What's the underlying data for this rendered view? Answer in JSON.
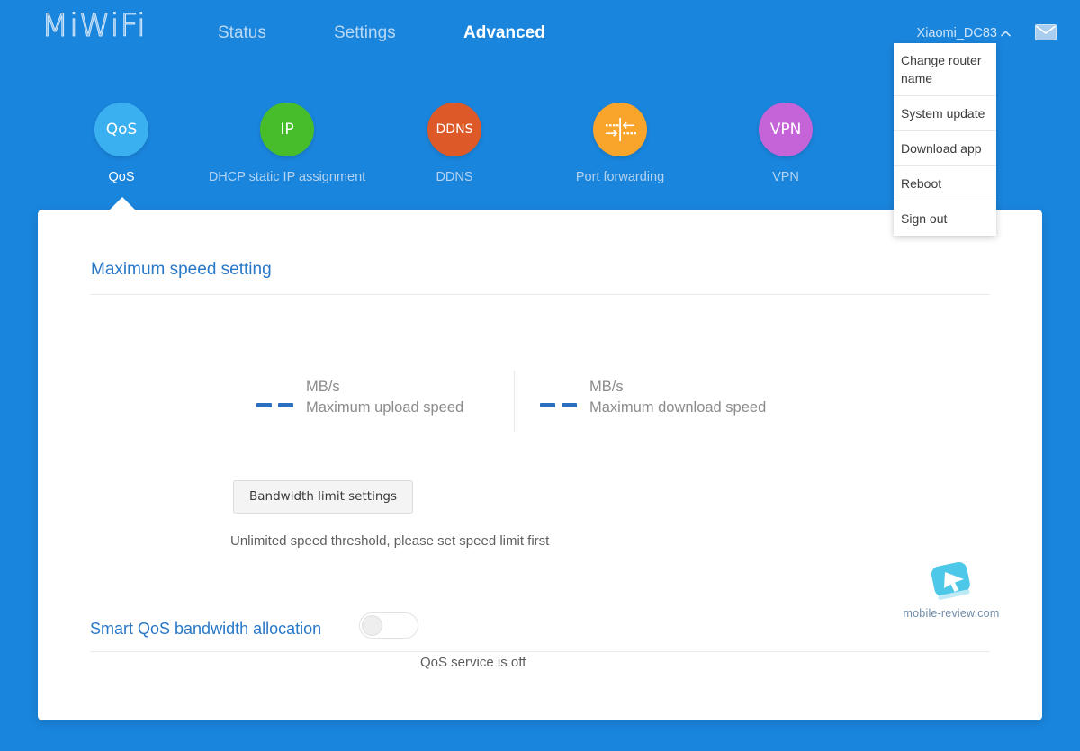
{
  "theme": {
    "background": "#1a85dd",
    "card_background": "#ffffff",
    "accent_link": "#2878c8",
    "accent_dash": "#2b6fc0",
    "nav_inactive": "#b9d8f4",
    "nav_active": "#ffffff"
  },
  "header": {
    "logo": "MiWiFi",
    "nav": [
      {
        "label": "Status",
        "active": false
      },
      {
        "label": "Settings",
        "active": false
      },
      {
        "label": "Advanced",
        "active": true
      }
    ],
    "router_name": "Xiaomi_DC83",
    "caret_icon": "chevron-up-icon",
    "mail_icon": "envelope-icon"
  },
  "router_menu": {
    "expanded": true,
    "items": [
      "Change router name",
      "System update",
      "Download app",
      "Reboot",
      "Sign out"
    ]
  },
  "feature_icons": [
    {
      "glyph": "QoS",
      "label": "QoS",
      "color": "#3ab0f0",
      "active": true,
      "icon_name": "qos-icon"
    },
    {
      "glyph": "IP",
      "label": "DHCP static IP assignment",
      "color": "#48bd2c",
      "active": false,
      "icon_name": "dhcp-static-ip-icon"
    },
    {
      "glyph": "DDNS",
      "label": "DDNS",
      "color": "#dd5a28",
      "active": false,
      "icon_name": "ddns-icon"
    },
    {
      "glyph": "",
      "label": "Port forwarding",
      "color": "#f9a42a",
      "active": false,
      "icon_name": "port-forwarding-icon"
    },
    {
      "glyph": "VPN",
      "label": "VPN",
      "color": "#c464d8",
      "active": false,
      "icon_name": "vpn-icon"
    }
  ],
  "main": {
    "title": "Maximum speed setting",
    "upload": {
      "value": "--",
      "unit": "MB/s",
      "caption": "Maximum upload speed"
    },
    "download": {
      "value": "--",
      "unit": "MB/s",
      "caption": "Maximum download speed"
    },
    "bandwidth_button": "Bandwidth limit settings",
    "hint": "Unlimited speed threshold, please set speed limit first",
    "smart_qos": {
      "label": "Smart QoS bandwidth allocation",
      "toggle_state": "off",
      "status": "QoS service is off"
    }
  },
  "watermark": {
    "text": "mobile-review.com",
    "mark_color": "#4ec8e8"
  }
}
